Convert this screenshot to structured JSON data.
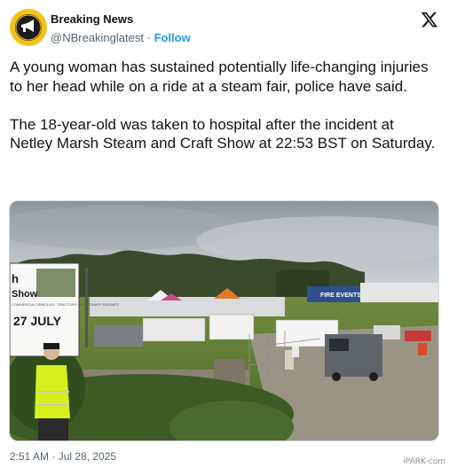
{
  "author": {
    "display_name": "Breaking News",
    "handle": "@NBreakinglatest",
    "separator": "·",
    "follow_label": "Follow",
    "avatar_logo_text": "BREAKING NEWS"
  },
  "platform_icon": "x-logo-icon",
  "post": {
    "paragraphs": [
      "A young woman has sustained potentially life-changing injuries to her head while on a ride at a steam fair, police have said.",
      "The 18-year-old was taken to hospital after the incident at Netley Marsh Steam and Craft Show at 22:53 BST on Saturday."
    ]
  },
  "media": {
    "sign_lines": [
      "h",
      "Show",
      "27 JULY"
    ],
    "sign_small_text": "COMMERCIAL VEHICLES · TRACTORS · STATIONARY ENGINES",
    "banner_text": "FIRE EVENTS"
  },
  "meta": {
    "timestamp": "2:51 AM · Jul 28, 2025"
  },
  "watermark": "iPARK·com",
  "colors": {
    "follow": "#1d9bf0",
    "avatar_bg": "#f2c21a",
    "secondary_text": "#536471"
  }
}
